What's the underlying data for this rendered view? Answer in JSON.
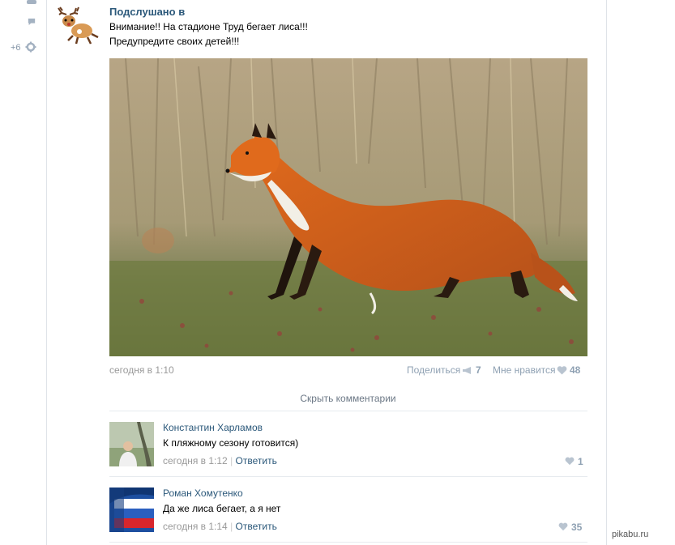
{
  "sidebar": {
    "more_count": "+6"
  },
  "post": {
    "author": "Подслушано в",
    "text_line1": "Внимание!! На стадионе Труд бегает лиса!!!",
    "text_line2": "Предупредите своих детей!!!",
    "timestamp": "сегодня в 1:10",
    "share_label": "Поделиться",
    "share_count": "7",
    "like_label": "Мне нравится",
    "like_count": "48"
  },
  "comments_toggle": "Скрыть комментарии",
  "comments": [
    {
      "author": "Константин Харламов",
      "text": "К пляжному сезону готовится)",
      "timestamp": "сегодня в 1:12",
      "separator": "|",
      "reply_label": "Ответить",
      "likes": "1"
    },
    {
      "author": "Роман Хомутенко",
      "text": "Да же лиса бегает, а я нет",
      "timestamp": "сегодня в 1:14",
      "separator": "|",
      "reply_label": "Ответить",
      "likes": "35"
    }
  ],
  "watermark": "pikabu.ru",
  "colors": {
    "link": "#2b587a",
    "muted": "#8fa1b3",
    "border": "#dfe3e8"
  }
}
